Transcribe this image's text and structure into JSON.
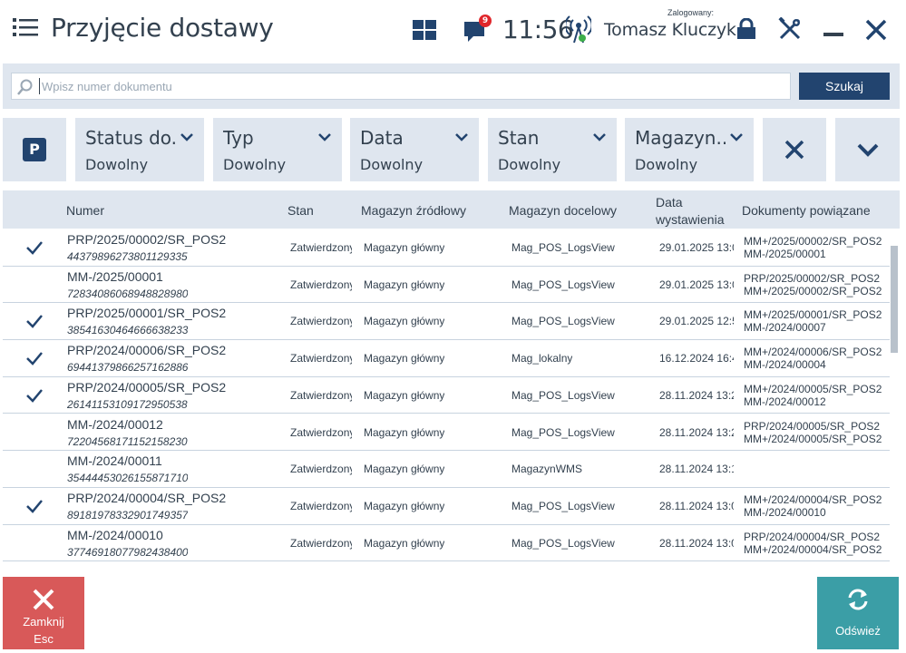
{
  "header": {
    "title": "Przyjęcie dostawy",
    "notification_count": "9",
    "time": "11:56",
    "logged_label": "Zalogowany:",
    "user_name": "Tomasz Kluczyk"
  },
  "search": {
    "placeholder": "Wpisz numer dokumentu",
    "button_label": "Szukaj"
  },
  "filters": [
    {
      "label": "Status do...",
      "value": "Dowolny"
    },
    {
      "label": "Typ",
      "value": "Dowolny"
    },
    {
      "label": "Data",
      "value": "Dowolny"
    },
    {
      "label": "Stan",
      "value": "Dowolny"
    },
    {
      "label": "Magazyn...",
      "value": "Dowolny"
    }
  ],
  "p_button_label": "P",
  "table": {
    "headers": {
      "number": "Numer",
      "state": "Stan",
      "source": "Magazyn źródłowy",
      "target": "Magazyn docelowy",
      "date_line1": "Data",
      "date_line2": "wystawienia",
      "related": "Dokumenty powiązane"
    },
    "rows": [
      {
        "checked": true,
        "number": "PRP/2025/00002/SR_POS2",
        "code": "4437989627380112933​5",
        "state": "Zatwierdzony",
        "source": "Magazyn główny",
        "target": "Mag_POS_LogsView",
        "date": "29.01.2025 13:0",
        "related1": "MM+/2025/00002/SR_POS2",
        "related2": "MM-/2025/00001"
      },
      {
        "checked": false,
        "number": "MM-/2025/00001",
        "code": "72834086068948828980",
        "state": "Zatwierdzony",
        "source": "Magazyn główny",
        "target": "Mag_POS_LogsView",
        "date": "29.01.2025 13:0",
        "related1": "PRP/2025/00002/SR_POS2",
        "related2": "MM+/2025/00002/SR_POS2"
      },
      {
        "checked": true,
        "number": "PRP/2025/00001/SR_POS2",
        "code": "38541630464666638233",
        "state": "Zatwierdzony",
        "source": "Magazyn główny",
        "target": "Mag_POS_LogsView",
        "date": "29.01.2025 12:5",
        "related1": "MM+/2025/00001/SR_POS2",
        "related2": "MM-/2024/00007"
      },
      {
        "checked": true,
        "number": "PRP/2024/00006/SR_POS2",
        "code": "69441379866257162886",
        "state": "Zatwierdzony",
        "source": "Magazyn główny",
        "target": "Mag_lokalny",
        "date": "16.12.2024 16:4",
        "related1": "MM+/2024/00006/SR_POS2",
        "related2": "MM-/2024/00004"
      },
      {
        "checked": true,
        "number": "PRP/2024/00005/SR_POS2",
        "code": "26141153109172950538",
        "state": "Zatwierdzony",
        "source": "Magazyn główny",
        "target": "Mag_POS_LogsView",
        "date": "28.11.2024 13:2",
        "related1": "MM+/2024/00005/SR_POS2",
        "related2": "MM-/2024/00012"
      },
      {
        "checked": false,
        "number": "MM-/2024/00012",
        "code": "72204568171152158230",
        "state": "Zatwierdzony",
        "source": "Magazyn główny",
        "target": "Mag_POS_LogsView",
        "date": "28.11.2024 13:2",
        "related1": "PRP/2024/00005/SR_POS2",
        "related2": "MM+/2024/00005/SR_POS2"
      },
      {
        "checked": false,
        "number": "MM-/2024/00011",
        "code": "35444453026155871710",
        "state": "Zatwierdzony",
        "source": "Magazyn główny",
        "target": "MagazynWMS",
        "date": "28.11.2024 13:1",
        "related1": "",
        "related2": ""
      },
      {
        "checked": true,
        "number": "PRP/2024/00004/SR_POS2",
        "code": "89181978332901749357",
        "state": "Zatwierdzony",
        "source": "Magazyn główny",
        "target": "Mag_POS_LogsView",
        "date": "28.11.2024 13:0",
        "related1": "MM+/2024/00004/SR_POS2",
        "related2": "MM-/2024/00010"
      },
      {
        "checked": false,
        "number": "MM-/2024/00010",
        "code": "37746918077982438400",
        "state": "Zatwierdzony",
        "source": "Magazyn główny",
        "target": "Mag_POS_LogsView",
        "date": "28.11.2024 13:0",
        "related1": "PRP/2024/00004/SR_POS2",
        "related2": "MM+/2024/00004/SR_POS2"
      }
    ]
  },
  "buttons": {
    "close_label": "Zamknij",
    "close_key": "Esc",
    "refresh_label": "Odśwież"
  },
  "colors": {
    "accent": "#22446f",
    "panel": "#dfe6ef",
    "close_button": "#d85959",
    "refresh_button": "#3b9ea6",
    "badge": "#e0262b"
  }
}
